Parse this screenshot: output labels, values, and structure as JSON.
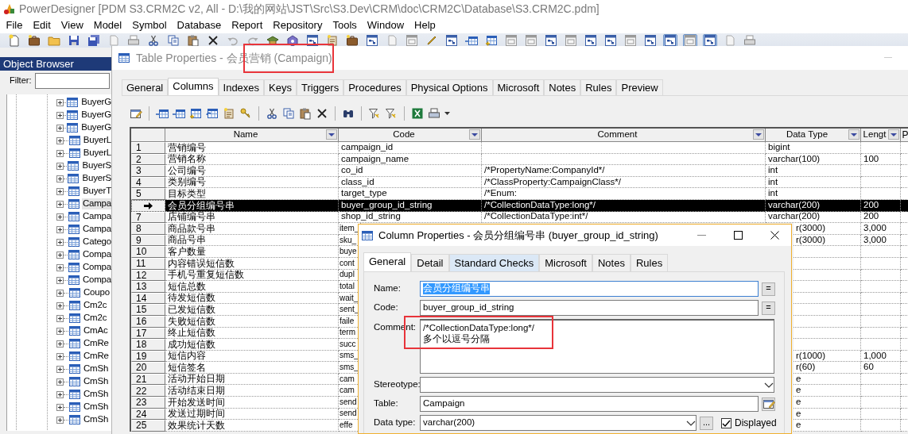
{
  "app": {
    "title": "PowerDesigner [PDM S3.CRM2C v2, All - D:\\我的网站\\JST\\Src\\S3.Dev\\CRM\\doc\\CRM2C\\Database\\S3.CRM2C.pdm]"
  },
  "menu": [
    "File",
    "Edit",
    "View",
    "Model",
    "Symbol",
    "Database",
    "Report",
    "Repository",
    "Tools",
    "Window",
    "Help"
  ],
  "view_toggles": [
    {
      "pressed": false
    },
    {
      "pressed": false
    },
    {
      "pressed": false
    },
    {
      "pressed": false
    },
    {
      "pressed": false
    },
    {
      "pressed": false
    },
    {
      "pressed": true
    },
    {
      "pressed": true
    },
    {
      "pressed": true
    }
  ],
  "object_browser": {
    "title": "Object Browser",
    "filter_label": "Filter:",
    "items": [
      {
        "label": "BuyerG",
        "selected": false
      },
      {
        "label": "BuyerG",
        "selected": false
      },
      {
        "label": "BuyerG",
        "selected": false
      },
      {
        "label": "BuyerL",
        "selected": false
      },
      {
        "label": "BuyerL",
        "selected": false
      },
      {
        "label": "BuyerS",
        "selected": false
      },
      {
        "label": "BuyerS",
        "selected": false
      },
      {
        "label": "BuyerT",
        "selected": false
      },
      {
        "label": "Campa",
        "selected": true
      },
      {
        "label": "Campa",
        "selected": false
      },
      {
        "label": "Campa",
        "selected": false
      },
      {
        "label": "Catego",
        "selected": false
      },
      {
        "label": "Compa",
        "selected": false
      },
      {
        "label": "Compa",
        "selected": false
      },
      {
        "label": "Compa",
        "selected": false
      },
      {
        "label": "Coupo",
        "selected": false
      },
      {
        "label": "Cm2c",
        "selected": false
      },
      {
        "label": "Cm2c",
        "selected": false
      },
      {
        "label": "CmAc",
        "selected": false
      },
      {
        "label": "CmRe",
        "selected": false
      },
      {
        "label": "CmRe",
        "selected": false
      },
      {
        "label": "CmSh",
        "selected": false
      },
      {
        "label": "CmSh",
        "selected": false
      },
      {
        "label": "CmSh",
        "selected": false
      },
      {
        "label": "CmSh",
        "selected": false
      },
      {
        "label": "CmSh",
        "selected": false
      }
    ]
  },
  "table_dialog": {
    "title": "Table Properties - 会员营销 (Campaign)",
    "highlighted": true,
    "tabs": [
      {
        "label": "General",
        "selected": false
      },
      {
        "label": "Columns",
        "selected": true
      },
      {
        "label": "Indexes",
        "selected": false
      },
      {
        "label": "Keys",
        "selected": false
      },
      {
        "label": "Triggers",
        "selected": false
      },
      {
        "label": "Procedures",
        "selected": false
      },
      {
        "label": "Physical Options",
        "selected": false
      },
      {
        "label": "Microsoft",
        "selected": false
      },
      {
        "label": "Notes",
        "selected": false
      },
      {
        "label": "Rules",
        "selected": false
      },
      {
        "label": "Preview",
        "selected": false
      }
    ],
    "columns": [
      {
        "label": "Name",
        "filter": true
      },
      {
        "label": "Code",
        "filter": true
      },
      {
        "label": "Comment",
        "filter": true
      },
      {
        "label": "Data Type",
        "filter": true
      },
      {
        "label": "Lengt",
        "filter": true
      },
      {
        "label": "P",
        "filter": false
      }
    ],
    "rows": [
      {
        "number": "1",
        "name": "营销编号",
        "code": "campaign_id",
        "data_type": "bigint",
        "selected": false
      },
      {
        "number": "2",
        "name": "营销名称",
        "code": "campaign_name",
        "data_type": "varchar(100)",
        "length": "100",
        "selected": false
      },
      {
        "number": "3",
        "name": "公司编号",
        "code": "co_id",
        "comment": "/*PropertyName:CompanyId*/",
        "data_type": "int",
        "selected": false
      },
      {
        "number": "4",
        "name": "类别编号",
        "code": "class_id",
        "comment": "/*ClassProperty:CampaignClass*/",
        "data_type": "int",
        "selected": false
      },
      {
        "number": "5",
        "name": "目标类型",
        "code": "target_type",
        "comment": "/*Enum:",
        "data_type": "int",
        "selected": false
      },
      {
        "name": "会员分组编号串",
        "code": "buyer_group_id_string",
        "comment": "/*CollectionDataType:long*/",
        "data_type": "varchar(200)",
        "length": "200",
        "selected": true
      },
      {
        "number": "7",
        "name": "店铺编号串",
        "code": "shop_id_string",
        "comment": "/*CollectionDataType:int*/",
        "data_type": "varchar(200)",
        "length": "200",
        "selected": false
      },
      {
        "number": "8",
        "name": "商品款号串",
        "code": "item_",
        "data_type": "r(3000)",
        "length": "3,000",
        "selected": false
      },
      {
        "number": "9",
        "name": "商品号串",
        "code": "sku_",
        "data_type": "r(3000)",
        "length": "3,000",
        "selected": false
      },
      {
        "number": "10",
        "name": "客户数量",
        "code": "buye",
        "selected": false
      },
      {
        "number": "11",
        "name": "内容错误短信数",
        "code": "cont",
        "selected": false
      },
      {
        "number": "12",
        "name": "手机号重复短信数",
        "code": "dupl",
        "selected": false
      },
      {
        "number": "13",
        "name": "短信总数",
        "code": "total",
        "selected": false
      },
      {
        "number": "14",
        "name": "待发短信数",
        "code": "wait_",
        "selected": false
      },
      {
        "number": "15",
        "name": "已发短信数",
        "code": "sent_",
        "selected": false
      },
      {
        "number": "16",
        "name": "失败短信数",
        "code": "faile",
        "selected": false
      },
      {
        "number": "17",
        "name": "终止短信数",
        "code": "term",
        "selected": false
      },
      {
        "number": "18",
        "name": "成功短信数",
        "code": "succ",
        "selected": false
      },
      {
        "number": "19",
        "name": "短信内容",
        "code": "sms_",
        "data_type": "r(1000)",
        "length": "1,000",
        "selected": false
      },
      {
        "number": "20",
        "name": "短信签名",
        "code": "sms_",
        "data_type": "r(60)",
        "length": "60",
        "selected": false
      },
      {
        "number": "21",
        "name": "活动开始日期",
        "code": "cam",
        "data_type": "e",
        "selected": false
      },
      {
        "number": "22",
        "name": "活动结束日期",
        "code": "cam",
        "data_type": "e",
        "selected": false
      },
      {
        "number": "23",
        "name": "开始发送时间",
        "code": "send",
        "data_type": "e",
        "selected": false
      },
      {
        "number": "24",
        "name": "发送过期时间",
        "code": "send",
        "data_type": "e",
        "selected": false
      },
      {
        "number": "25",
        "name": "效果统计天数",
        "code": "effe",
        "data_type": "e",
        "selected": false
      }
    ]
  },
  "column_dialog": {
    "title": "Column Properties - 会员分组编号串 (buyer_group_id_string)",
    "tabs": [
      {
        "label": "General",
        "selected": true,
        "hover": false
      },
      {
        "label": "Detail",
        "selected": false,
        "hover": false
      },
      {
        "label": "Standard Checks",
        "selected": false,
        "hover": true
      },
      {
        "label": "Microsoft",
        "selected": false,
        "hover": false
      },
      {
        "label": "Notes",
        "selected": false,
        "hover": false
      },
      {
        "label": "Rules",
        "selected": false,
        "hover": false
      }
    ],
    "fields": [
      {
        "kind": "text",
        "label": "Name:",
        "value": "会员分组编号串",
        "text_selected": true,
        "button": "="
      },
      {
        "kind": "text",
        "label": "Code:",
        "value": "buyer_group_id_string",
        "button": "="
      },
      {
        "kind": "textarea",
        "label": "Comment:",
        "lines": [
          "/*CollectionDataType:long*/",
          "多个以逗号分隔"
        ],
        "highlighted": true
      },
      {
        "kind": "combo",
        "label": "Stereotype:"
      },
      {
        "kind": "text",
        "label": "Table:",
        "value": "Campaign",
        "properties_button": true
      },
      {
        "kind": "combo",
        "label": "Data type:",
        "value": "varchar(200)",
        "button": "...",
        "checkbox": {
          "label": "Displayed",
          "checked": true
        }
      }
    ]
  }
}
